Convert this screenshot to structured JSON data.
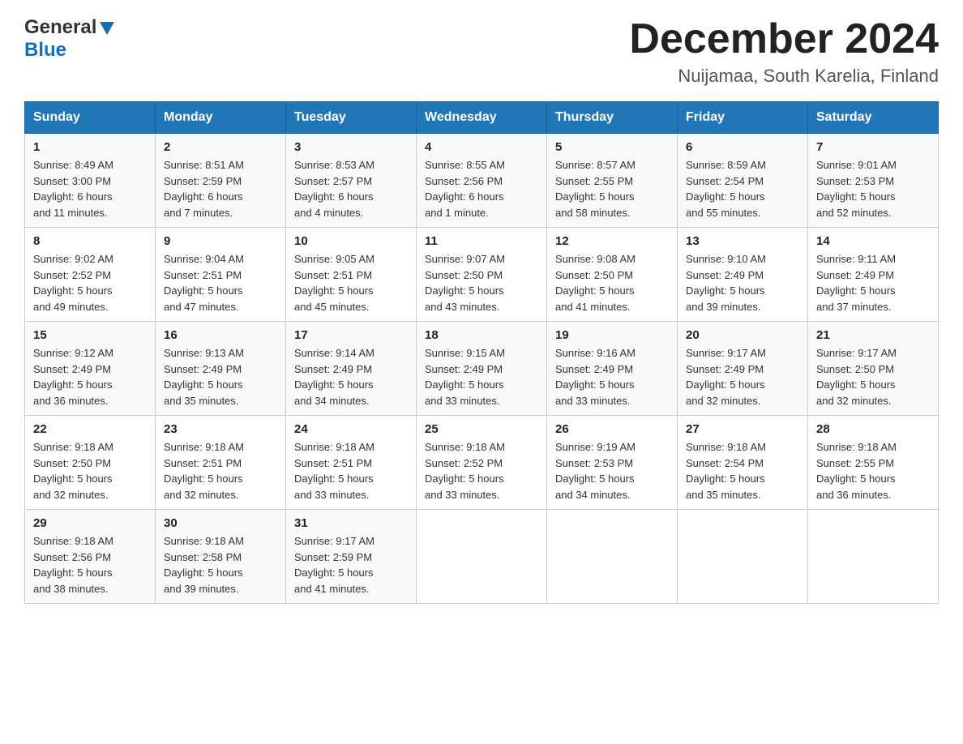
{
  "header": {
    "logo_general": "General",
    "logo_blue": "Blue",
    "month_title": "December 2024",
    "location": "Nuijamaa, South Karelia, Finland"
  },
  "days_of_week": [
    "Sunday",
    "Monday",
    "Tuesday",
    "Wednesday",
    "Thursday",
    "Friday",
    "Saturday"
  ],
  "weeks": [
    [
      {
        "day": "1",
        "sunrise": "Sunrise: 8:49 AM",
        "sunset": "Sunset: 3:00 PM",
        "daylight": "Daylight: 6 hours",
        "daylight2": "and 11 minutes."
      },
      {
        "day": "2",
        "sunrise": "Sunrise: 8:51 AM",
        "sunset": "Sunset: 2:59 PM",
        "daylight": "Daylight: 6 hours",
        "daylight2": "and 7 minutes."
      },
      {
        "day": "3",
        "sunrise": "Sunrise: 8:53 AM",
        "sunset": "Sunset: 2:57 PM",
        "daylight": "Daylight: 6 hours",
        "daylight2": "and 4 minutes."
      },
      {
        "day": "4",
        "sunrise": "Sunrise: 8:55 AM",
        "sunset": "Sunset: 2:56 PM",
        "daylight": "Daylight: 6 hours",
        "daylight2": "and 1 minute."
      },
      {
        "day": "5",
        "sunrise": "Sunrise: 8:57 AM",
        "sunset": "Sunset: 2:55 PM",
        "daylight": "Daylight: 5 hours",
        "daylight2": "and 58 minutes."
      },
      {
        "day": "6",
        "sunrise": "Sunrise: 8:59 AM",
        "sunset": "Sunset: 2:54 PM",
        "daylight": "Daylight: 5 hours",
        "daylight2": "and 55 minutes."
      },
      {
        "day": "7",
        "sunrise": "Sunrise: 9:01 AM",
        "sunset": "Sunset: 2:53 PM",
        "daylight": "Daylight: 5 hours",
        "daylight2": "and 52 minutes."
      }
    ],
    [
      {
        "day": "8",
        "sunrise": "Sunrise: 9:02 AM",
        "sunset": "Sunset: 2:52 PM",
        "daylight": "Daylight: 5 hours",
        "daylight2": "and 49 minutes."
      },
      {
        "day": "9",
        "sunrise": "Sunrise: 9:04 AM",
        "sunset": "Sunset: 2:51 PM",
        "daylight": "Daylight: 5 hours",
        "daylight2": "and 47 minutes."
      },
      {
        "day": "10",
        "sunrise": "Sunrise: 9:05 AM",
        "sunset": "Sunset: 2:51 PM",
        "daylight": "Daylight: 5 hours",
        "daylight2": "and 45 minutes."
      },
      {
        "day": "11",
        "sunrise": "Sunrise: 9:07 AM",
        "sunset": "Sunset: 2:50 PM",
        "daylight": "Daylight: 5 hours",
        "daylight2": "and 43 minutes."
      },
      {
        "day": "12",
        "sunrise": "Sunrise: 9:08 AM",
        "sunset": "Sunset: 2:50 PM",
        "daylight": "Daylight: 5 hours",
        "daylight2": "and 41 minutes."
      },
      {
        "day": "13",
        "sunrise": "Sunrise: 9:10 AM",
        "sunset": "Sunset: 2:49 PM",
        "daylight": "Daylight: 5 hours",
        "daylight2": "and 39 minutes."
      },
      {
        "day": "14",
        "sunrise": "Sunrise: 9:11 AM",
        "sunset": "Sunset: 2:49 PM",
        "daylight": "Daylight: 5 hours",
        "daylight2": "and 37 minutes."
      }
    ],
    [
      {
        "day": "15",
        "sunrise": "Sunrise: 9:12 AM",
        "sunset": "Sunset: 2:49 PM",
        "daylight": "Daylight: 5 hours",
        "daylight2": "and 36 minutes."
      },
      {
        "day": "16",
        "sunrise": "Sunrise: 9:13 AM",
        "sunset": "Sunset: 2:49 PM",
        "daylight": "Daylight: 5 hours",
        "daylight2": "and 35 minutes."
      },
      {
        "day": "17",
        "sunrise": "Sunrise: 9:14 AM",
        "sunset": "Sunset: 2:49 PM",
        "daylight": "Daylight: 5 hours",
        "daylight2": "and 34 minutes."
      },
      {
        "day": "18",
        "sunrise": "Sunrise: 9:15 AM",
        "sunset": "Sunset: 2:49 PM",
        "daylight": "Daylight: 5 hours",
        "daylight2": "and 33 minutes."
      },
      {
        "day": "19",
        "sunrise": "Sunrise: 9:16 AM",
        "sunset": "Sunset: 2:49 PM",
        "daylight": "Daylight: 5 hours",
        "daylight2": "and 33 minutes."
      },
      {
        "day": "20",
        "sunrise": "Sunrise: 9:17 AM",
        "sunset": "Sunset: 2:49 PM",
        "daylight": "Daylight: 5 hours",
        "daylight2": "and 32 minutes."
      },
      {
        "day": "21",
        "sunrise": "Sunrise: 9:17 AM",
        "sunset": "Sunset: 2:50 PM",
        "daylight": "Daylight: 5 hours",
        "daylight2": "and 32 minutes."
      }
    ],
    [
      {
        "day": "22",
        "sunrise": "Sunrise: 9:18 AM",
        "sunset": "Sunset: 2:50 PM",
        "daylight": "Daylight: 5 hours",
        "daylight2": "and 32 minutes."
      },
      {
        "day": "23",
        "sunrise": "Sunrise: 9:18 AM",
        "sunset": "Sunset: 2:51 PM",
        "daylight": "Daylight: 5 hours",
        "daylight2": "and 32 minutes."
      },
      {
        "day": "24",
        "sunrise": "Sunrise: 9:18 AM",
        "sunset": "Sunset: 2:51 PM",
        "daylight": "Daylight: 5 hours",
        "daylight2": "and 33 minutes."
      },
      {
        "day": "25",
        "sunrise": "Sunrise: 9:18 AM",
        "sunset": "Sunset: 2:52 PM",
        "daylight": "Daylight: 5 hours",
        "daylight2": "and 33 minutes."
      },
      {
        "day": "26",
        "sunrise": "Sunrise: 9:19 AM",
        "sunset": "Sunset: 2:53 PM",
        "daylight": "Daylight: 5 hours",
        "daylight2": "and 34 minutes."
      },
      {
        "day": "27",
        "sunrise": "Sunrise: 9:18 AM",
        "sunset": "Sunset: 2:54 PM",
        "daylight": "Daylight: 5 hours",
        "daylight2": "and 35 minutes."
      },
      {
        "day": "28",
        "sunrise": "Sunrise: 9:18 AM",
        "sunset": "Sunset: 2:55 PM",
        "daylight": "Daylight: 5 hours",
        "daylight2": "and 36 minutes."
      }
    ],
    [
      {
        "day": "29",
        "sunrise": "Sunrise: 9:18 AM",
        "sunset": "Sunset: 2:56 PM",
        "daylight": "Daylight: 5 hours",
        "daylight2": "and 38 minutes."
      },
      {
        "day": "30",
        "sunrise": "Sunrise: 9:18 AM",
        "sunset": "Sunset: 2:58 PM",
        "daylight": "Daylight: 5 hours",
        "daylight2": "and 39 minutes."
      },
      {
        "day": "31",
        "sunrise": "Sunrise: 9:17 AM",
        "sunset": "Sunset: 2:59 PM",
        "daylight": "Daylight: 5 hours",
        "daylight2": "and 41 minutes."
      },
      null,
      null,
      null,
      null
    ]
  ]
}
